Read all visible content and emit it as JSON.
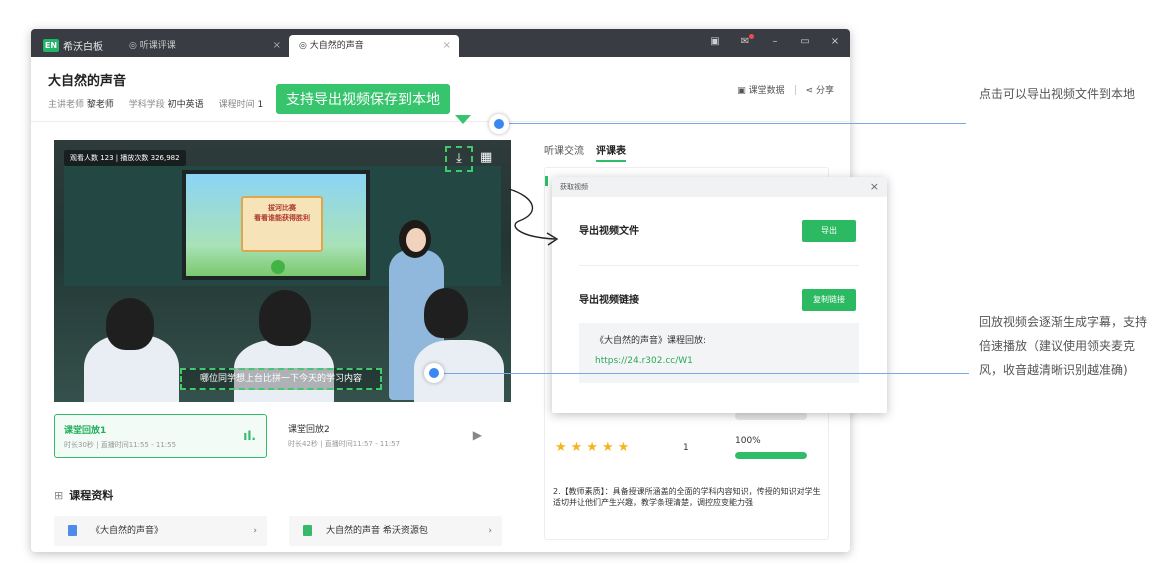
{
  "titlebar": {
    "app_badge": "EN",
    "app_title": "希沃白板",
    "tabs": [
      {
        "label": "听课评课",
        "close": "×"
      },
      {
        "label": "大自然的声音",
        "close": "×"
      }
    ],
    "min": "–",
    "max": "▭",
    "close": "×"
  },
  "course": {
    "title": "大自然的声音",
    "lecturer_label": "主讲老师",
    "lecturer": "黎老师",
    "subject_label": "学科学段",
    "subject": "初中英语",
    "time_label": "课程时间",
    "time_value": "1",
    "data_label": "课堂数据",
    "share_label": "分享"
  },
  "video": {
    "stats": "观看人数 123 | 播放次数 326,982",
    "poster_line1": "拔河比赛",
    "poster_line2": "看看谁能获得胜利",
    "subtitle": "哪位同学想上台比拼一下今天的学习内容"
  },
  "callout": {
    "text": "支持导出视频保存到本地"
  },
  "segments": [
    {
      "title": "课堂回放1",
      "meta": "时长30秒 | 直播时间11:55 - 11:55",
      "indicator": "ıl."
    },
    {
      "title": "课堂回放2",
      "meta": "时长42秒 | 直播时间11:57 - 11:57",
      "indicator": "▶"
    }
  ],
  "materials": {
    "heading": "课程资料",
    "items": [
      {
        "label": "《大自然的声音》",
        "chev": "›"
      },
      {
        "label": "大自然的声音 希沃资源包",
        "chev": "›"
      }
    ]
  },
  "right": {
    "tabs": [
      "听课交流",
      "评课表"
    ],
    "stars": "★★★★★",
    "count": "1",
    "percent_label": "100%",
    "percent_value": 100,
    "comment": "2.【教师素质】：具备授课所涵盖的全面的学科内容知识，传授的知识对学生适切并让他们产生兴趣，教学条理清楚，调控应变能力强"
  },
  "dialog": {
    "title": "获取视频",
    "close": "×",
    "export_label": "导出视频文件",
    "export_btn": "导出",
    "link_label": "导出视频链接",
    "copy_btn": "复制链接",
    "link_title": "《大自然的声音》课程回放:",
    "link_url": "https://24.r302.cc/W1"
  },
  "notes": {
    "export": "点击可以导出视频文件到本地",
    "subtitle": "回放视频会逐渐生成字幕，支持倍速播放（建议使用领夹麦克风，收音越清晰识别越准确)"
  },
  "colors": {
    "accent": "#2fbd69",
    "dot": "#3b86f0"
  }
}
